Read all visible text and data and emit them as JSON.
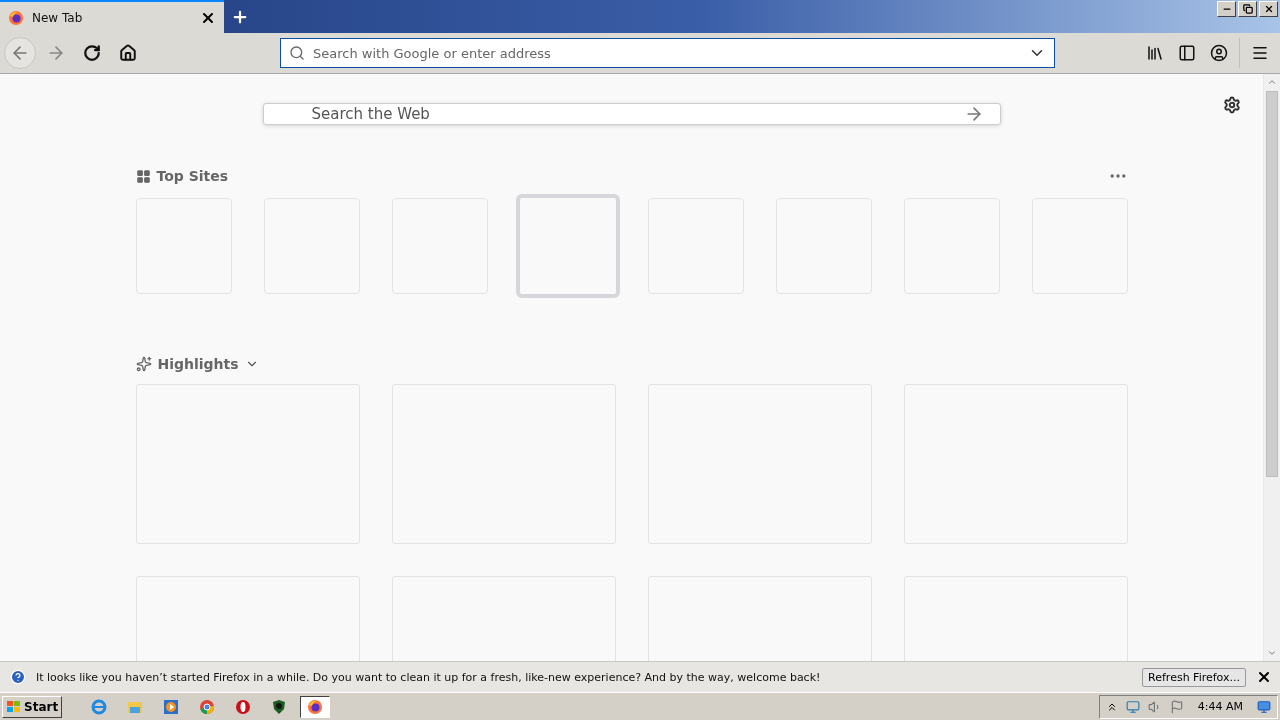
{
  "tab": {
    "title": "New Tab",
    "selected": true
  },
  "address_bar": {
    "placeholder": "Search with Google or enter address"
  },
  "search": {
    "placeholder": "Search the Web"
  },
  "top_sites": {
    "title": "Top Sites",
    "tiles": [
      {
        "focused": false
      },
      {
        "focused": false
      },
      {
        "focused": false
      },
      {
        "focused": true
      },
      {
        "focused": false
      },
      {
        "focused": false
      },
      {
        "focused": false
      },
      {
        "focused": false
      }
    ]
  },
  "highlights": {
    "title": "Highlights",
    "expanded": true,
    "cards": [
      {
        "kind": "empty"
      },
      {
        "kind": "empty"
      },
      {
        "kind": "empty"
      },
      {
        "kind": "empty"
      },
      {
        "kind": "empty"
      },
      {
        "kind": "empty"
      },
      {
        "kind": "empty"
      },
      {
        "kind": "empty"
      }
    ]
  },
  "notification": {
    "message": "It looks like you haven’t started Firefox in a while. Do you want to clean it up for a fresh, like-new experience? And by the way, welcome back!",
    "button": "Refresh Firefox..."
  },
  "taskbar": {
    "start": "Start",
    "apps": [
      {
        "kind": "ie",
        "selected": false
      },
      {
        "kind": "explorer",
        "selected": false
      },
      {
        "kind": "media",
        "selected": false
      },
      {
        "kind": "chrome",
        "selected": false
      },
      {
        "kind": "opera",
        "selected": false
      },
      {
        "kind": "shield",
        "selected": false
      },
      {
        "kind": "firefox",
        "selected": true
      }
    ],
    "clock": "4:44 AM"
  }
}
